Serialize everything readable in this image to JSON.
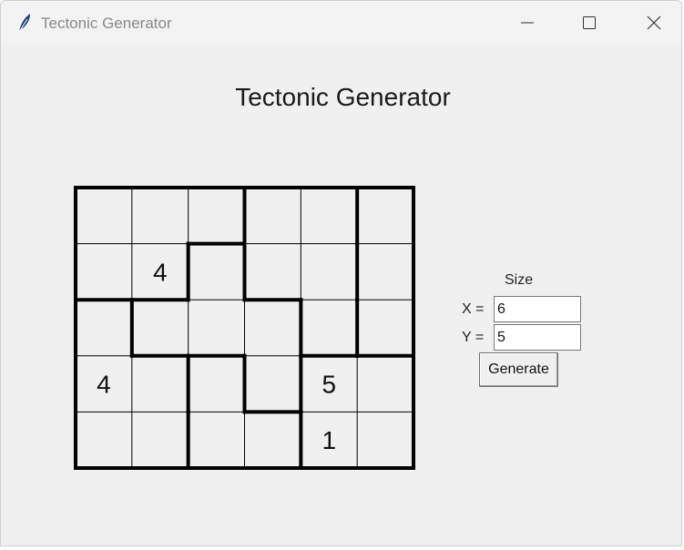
{
  "window": {
    "title": "Tectonic Generator",
    "icon": "feather-icon",
    "controls": [
      "minimize-icon",
      "maximize-icon",
      "close-icon"
    ]
  },
  "heading": "Tectonic Generator",
  "puzzle": {
    "cols": 6,
    "rows": 5,
    "regions": [
      [
        "A",
        "A",
        "A",
        "B",
        "B",
        "C"
      ],
      [
        "A",
        "A",
        "D",
        "B",
        "B",
        "C"
      ],
      [
        "E",
        "D",
        "D",
        "D",
        "B",
        "C"
      ],
      [
        "E",
        "E",
        "F",
        "D",
        "G",
        "G"
      ],
      [
        "E",
        "E",
        "F",
        "F",
        "G",
        "G"
      ]
    ],
    "givens": [
      [
        "",
        "",
        "",
        "",
        "",
        ""
      ],
      [
        "",
        "4",
        "",
        "",
        "",
        ""
      ],
      [
        "",
        "",
        "",
        "",
        "",
        ""
      ],
      [
        "4",
        "",
        "",
        "",
        "5",
        ""
      ],
      [
        "",
        "",
        "",
        "",
        "1",
        ""
      ]
    ]
  },
  "size_panel": {
    "label": "Size",
    "x_label": "X =",
    "x_value": "6",
    "y_label": "Y =",
    "y_value": "5",
    "generate_label": "Generate"
  },
  "colors": {
    "window_bg": "#f0f0f0",
    "grid_line": "#000000",
    "cell_bg": "#f0f0f0"
  }
}
